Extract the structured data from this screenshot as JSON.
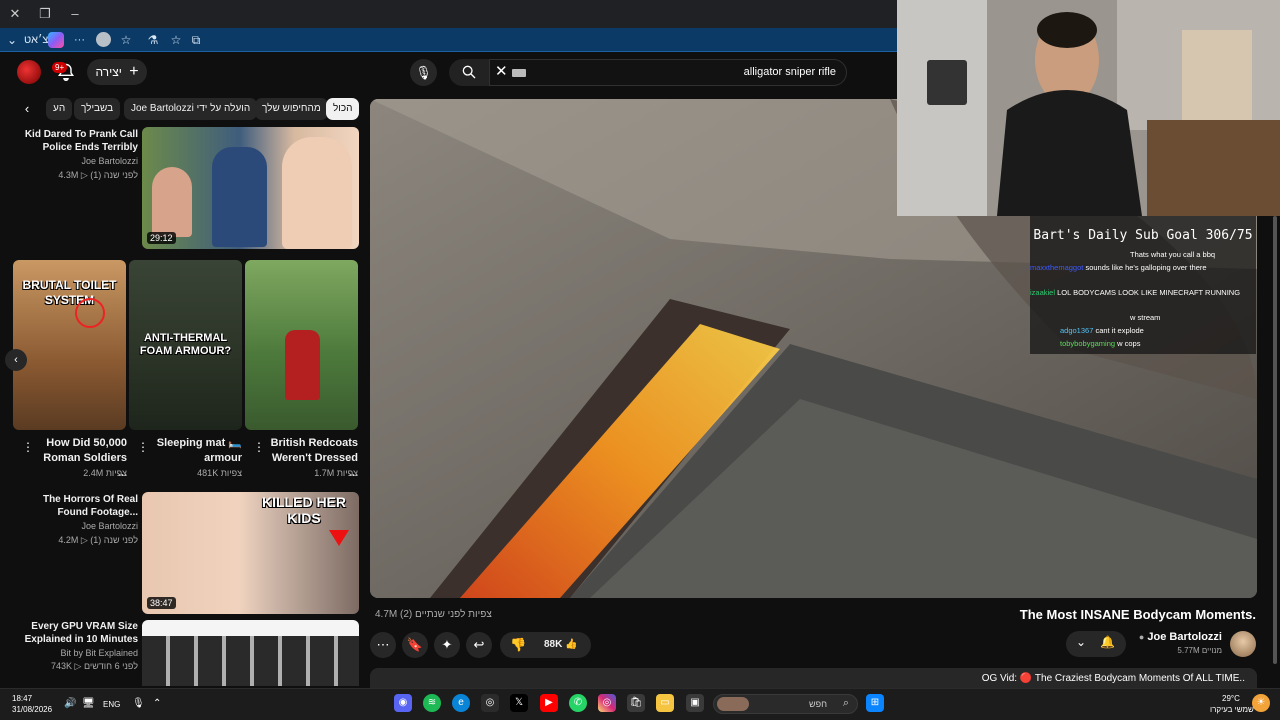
{
  "browser": {
    "profile_label": "צ׳אט",
    "more_label": "···"
  },
  "youtube": {
    "notifications_badge": "9+",
    "create_label": "יצירה",
    "search_value": "alligator sniper rifle"
  },
  "chips": [
    "הכול",
    "מהחיפוש שלך",
    "Joe Bartolozzi הועלה על ידי",
    "בשבילך",
    "הע"
  ],
  "recommended": [
    {
      "title": "Kid Dared To Prank Call Police Ends Terribly",
      "channel": "Joe Bartolozzi",
      "meta": "4.3M ▷ לפני שנה (1)",
      "duration": "29:12"
    },
    {
      "title": "The Horrors Of Real Found Footage...",
      "channel": "Joe Bartolozzi",
      "meta": "4.2M ▷ לפני שנה (1)",
      "duration": "38:47",
      "overlay": "KILLED HER KIDS"
    },
    {
      "title": "Every GPU VRAM Size Explained in 10 Minutes",
      "channel": "Bit by Bit Explained",
      "meta": "743K ▷ לפני 6 חודשים",
      "duration": ""
    }
  ],
  "shorts": [
    {
      "title": "How Did 50,000 Roman Soldiers ...",
      "views": "2.4M צפיות",
      "overlay": "BRUTAL TOILET SYSTEM"
    },
    {
      "title": "Sleeping mat 🛏️ armour",
      "views": "481K צפיות",
      "overlay": "ANTI-THERMAL FOAM ARMOUR?"
    },
    {
      "title": "British Redcoats Weren't Dressed ...",
      "views": "1.7M צפיות",
      "overlay": ""
    }
  ],
  "video": {
    "title": "The Most INSANE Bodycam Moments.",
    "views_line": "4.7M צפיות  לפני שנתיים (2)",
    "likes": "88K",
    "channel": "Joe Bartolozzi",
    "subscribers": "5.77M מנויים",
    "description": "OG Vid: 🔴 The Craziest Bodycam Moments Of ALL TIME.."
  },
  "chat": {
    "goal": "Bart's Daily Sub Goal 306/75",
    "messages": [
      {
        "user": "",
        "text": "Thats what you call a bbq",
        "color": "#8a2be2"
      },
      {
        "user": "maxxthemaggot",
        "text": "sounds like he's galloping over there",
        "color": "#3b5bff"
      },
      {
        "user": "izaakiel",
        "text": "LOL BODYCAMS LOOK LIKE MINECRAFT RUNNING",
        "color": "#2ecc71"
      },
      {
        "user": "",
        "text": "w stream",
        "color": "#cc2222"
      },
      {
        "user": "adgo1367",
        "text": "cant it explode",
        "color": "#4fc3f7"
      },
      {
        "user": "tobybobygaming",
        "text": "w cops",
        "color": "#5cdb5c"
      }
    ]
  },
  "taskbar": {
    "time": "18:47",
    "date": "31/08/2026",
    "lang": "ENG",
    "search_placeholder": "חפש",
    "weather_temp": "29°C",
    "weather_desc": "שמשי בעיקרו"
  }
}
